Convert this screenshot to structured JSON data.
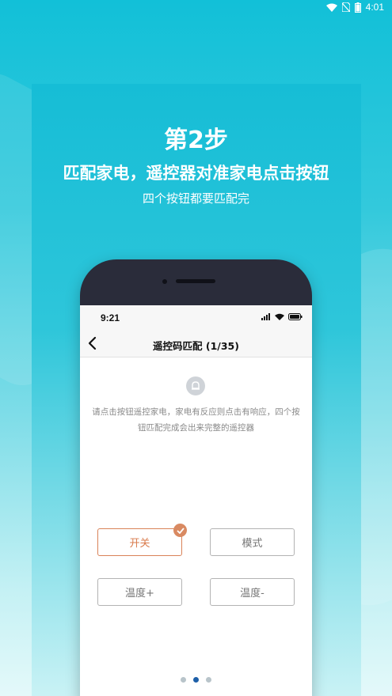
{
  "status_bar": {
    "time": "4:01"
  },
  "header": {
    "title": "第2步",
    "subtitle": "匹配家电，遥控器对准家电点击按钮",
    "note": "四个按钮都要匹配完"
  },
  "phone": {
    "time": "9:21",
    "nav_title": "遥控码匹配 (1/35)",
    "instruction": "请点击按钮遥控家电，家电有反应则点击有响应，四个按钮匹配完成会出来完整的遥控器",
    "buttons": [
      {
        "label": "开关",
        "selected": true
      },
      {
        "label": "模式",
        "selected": false
      },
      {
        "label": "温度+",
        "selected": false
      },
      {
        "label": "温度-",
        "selected": false
      }
    ]
  },
  "pager": {
    "count": 3,
    "active_index": 1
  },
  "colors": {
    "accent": "#d98258",
    "background_top": "#12c0d8",
    "pager_active": "#1d5fa8"
  }
}
